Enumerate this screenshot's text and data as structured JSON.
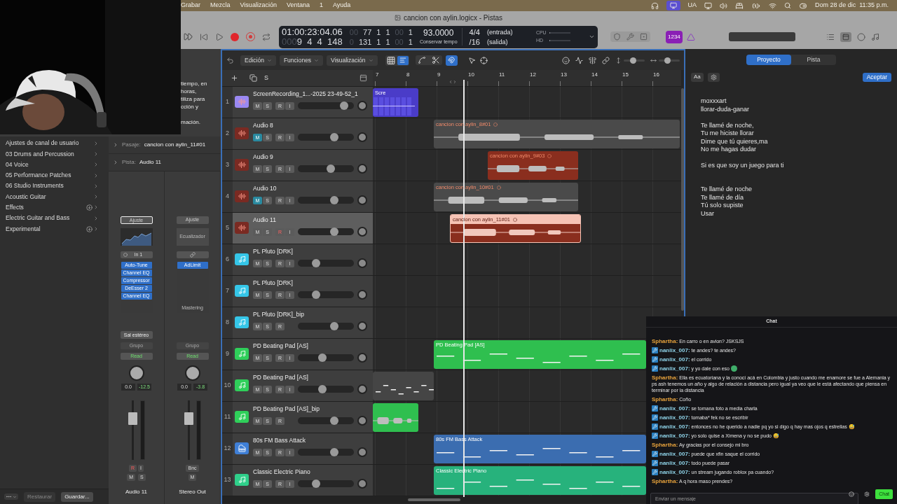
{
  "menubar": {
    "menus": [
      "Grabar",
      "Mezcla",
      "Visualización",
      "Ventana",
      "1",
      "Ayuda"
    ],
    "keyboard_layout": "UA",
    "clock": "Dom 28 de dic  11:35 p.m."
  },
  "window": {
    "title": "cancion con aylin.logicx - Pistas"
  },
  "lcd": {
    "smpte": "01:00:23:04.06",
    "bars": [
      {
        "text": "000",
        "dim": true
      },
      {
        "text": "9  4  4  148",
        "dim": false
      }
    ],
    "locator_in": [
      {
        "text": "00",
        "dim": true
      },
      {
        "text": "77",
        "dim": false
      },
      {
        "text": "1",
        "dim": false
      },
      {
        "text": "1",
        "dim": false
      },
      {
        "text": "00",
        "dim": true
      },
      {
        "text": "1",
        "dim": false
      }
    ],
    "locator_out": [
      {
        "text": "0",
        "dim": true
      },
      {
        "text": "131",
        "dim": false
      },
      {
        "text": "1",
        "dim": false
      },
      {
        "text": "1",
        "dim": false
      },
      {
        "text": "00",
        "dim": true
      },
      {
        "text": "1",
        "dim": false
      }
    ],
    "tempo": "93.0000",
    "tempo_mode": "Conservar tempo",
    "signature": "4/4",
    "division": "/16",
    "input_label": "(entrada)",
    "output_label": "(salida)",
    "meters": [
      {
        "label": "CPU",
        "level": 0.05
      },
      {
        "label": "HD",
        "level": 0.05
      }
    ]
  },
  "count_in": "1234",
  "help_text": [
    [
      "tiempo, en",
      "horas,",
      "tiliza para",
      "cción y"
    ],
    [
      "mación."
    ]
  ],
  "library": {
    "items": [
      {
        "label": "Ajustes de canal de usuario",
        "download": false
      },
      {
        "label": "03 Drums and Percussion",
        "download": false
      },
      {
        "label": "04 Voice",
        "download": false
      },
      {
        "label": "05 Performance Patches",
        "download": false
      },
      {
        "label": "06 Studio Instruments",
        "download": false
      },
      {
        "label": "Acoustic Guitar",
        "download": false
      },
      {
        "label": "Effects",
        "download": true
      },
      {
        "label": "Electric Guitar and Bass",
        "download": false
      },
      {
        "label": "Experimental",
        "download": true
      }
    ],
    "restore": "Restaurar",
    "save": "Guardar..."
  },
  "inspector": {
    "region_row": {
      "label": "Pasaje:",
      "value": "cancion con aylin_11#01"
    },
    "track_row": {
      "label": "Pista:",
      "value": "Audio 11"
    },
    "strips": [
      {
        "setting": "Ajuste",
        "setting_selected": true,
        "input": "In 1",
        "plugins": [
          "Auto-Tune",
          "Channel EQ",
          "Compressor",
          "DeEsser 2",
          "Channel EQ"
        ],
        "output": "Sal estéreo",
        "group": "Grupo",
        "automation": "Read",
        "volume": "0.0",
        "peak": "-12.5",
        "level": 0.75,
        "buttons": [
          {
            "kind": "record",
            "label": "R",
            "on": true
          },
          {
            "kind": "input",
            "label": "I",
            "on": false
          },
          {
            "kind": "mute",
            "label": "M",
            "on": false
          },
          {
            "kind": "solo",
            "label": "S",
            "on": false
          }
        ],
        "name": "Audio 11"
      },
      {
        "setting": "Ajuste",
        "setting_selected": false,
        "eq_label": "Ecualizador",
        "plugins": [
          "AdLimit"
        ],
        "slot_label": "Mastering",
        "group": "Grupo",
        "automation": "Read",
        "volume": "0.0",
        "peak": "-3.8",
        "level": 0.75,
        "buttons": [
          {
            "kind": "bounce",
            "label": "Bnc",
            "on": false
          },
          {
            "kind": "mute",
            "label": "M",
            "on": false
          }
        ],
        "name": "Stereo Out"
      }
    ]
  },
  "tracks_toolbar": {
    "menus": [
      "Edición",
      "Funciones",
      "Visualización"
    ],
    "zoom_sliders": [
      {
        "level": 0.45
      },
      {
        "level": 0.4
      }
    ]
  },
  "track_list_header": {
    "solo_label": "S"
  },
  "ruler": [
    "7",
    "8",
    "9",
    "10",
    "11",
    "12",
    "13",
    "14",
    "15",
    "16"
  ],
  "tracks": [
    {
      "number": "1",
      "name": "ScreenRecording_1...-2025 23-49-52_1",
      "kind": "audio",
      "color": "#9a88f2",
      "selected": false,
      "level": 0.88,
      "buttons": [
        {
          "kind": "mute",
          "label": "M",
          "on": false
        },
        {
          "kind": "solo",
          "label": "S",
          "on": false
        },
        {
          "kind": "record",
          "label": "R",
          "on": false
        },
        {
          "kind": "input",
          "label": "I",
          "on": false
        }
      ],
      "regions": [
        {
          "name": "Scre",
          "kind": "video",
          "color": "#4a3cc8",
          "selected": false,
          "looped": false
        }
      ]
    },
    {
      "number": "2",
      "name": "Audio 8",
      "kind": "audio",
      "color": "#7a2a22",
      "selected": false,
      "level": 0.68,
      "buttons": [
        {
          "kind": "mute",
          "label": "M",
          "on": true
        },
        {
          "kind": "solo",
          "label": "S",
          "on": false
        },
        {
          "kind": "record",
          "label": "R",
          "on": false
        },
        {
          "kind": "input",
          "label": "I",
          "on": false
        }
      ],
      "regions": [
        {
          "name": "cancion con aylin_8#01",
          "kind": "audio",
          "color": "#4a4a4a",
          "selected": false,
          "looped": true
        }
      ]
    },
    {
      "number": "3",
      "name": "Audio 9",
      "kind": "audio",
      "color": "#7a2a22",
      "selected": false,
      "level": 0.6,
      "buttons": [
        {
          "kind": "mute",
          "label": "M",
          "on": false
        },
        {
          "kind": "solo",
          "label": "S",
          "on": false
        },
        {
          "kind": "record",
          "label": "R",
          "on": false
        },
        {
          "kind": "input",
          "label": "I",
          "on": false
        }
      ],
      "regions": [
        {
          "name": "cancion con aylin_9#03",
          "kind": "audio",
          "color": "#8a2e1e",
          "selected": false,
          "looped": true
        }
      ]
    },
    {
      "number": "4",
      "name": "Audio 10",
      "kind": "audio",
      "color": "#7a2a22",
      "selected": false,
      "level": 0.68,
      "buttons": [
        {
          "kind": "mute",
          "label": "M",
          "on": true
        },
        {
          "kind": "solo",
          "label": "S",
          "on": false
        },
        {
          "kind": "record",
          "label": "R",
          "on": false
        },
        {
          "kind": "input",
          "label": "I",
          "on": false
        }
      ],
      "regions": [
        {
          "name": "cancion con aylin_10#01",
          "kind": "audio",
          "color": "#4a4a4a",
          "selected": false,
          "looped": true
        }
      ]
    },
    {
      "number": "5",
      "name": "Audio 11",
      "kind": "audio",
      "color": "#7a2a22",
      "selected": true,
      "level": 0.68,
      "buttons": [
        {
          "kind": "mute",
          "label": "M",
          "on": false
        },
        {
          "kind": "solo",
          "label": "S",
          "on": false
        },
        {
          "kind": "record",
          "label": "R",
          "on": true
        },
        {
          "kind": "input",
          "label": "I",
          "on": false
        }
      ],
      "regions": [
        {
          "name": "cancion con aylin_11#01",
          "kind": "audio",
          "color": "#8a2e1e",
          "selected": true,
          "looped": true
        }
      ]
    },
    {
      "number": "6",
      "name": "PL Pluto [DRK]",
      "kind": "instrument",
      "color": "#35c6e8",
      "selected": false,
      "level": 0.3,
      "buttons": [
        {
          "kind": "mute",
          "label": "M",
          "on": false
        },
        {
          "kind": "solo",
          "label": "S",
          "on": false
        },
        {
          "kind": "record",
          "label": "R",
          "on": false
        },
        {
          "kind": "input",
          "label": "I",
          "on": false
        }
      ]
    },
    {
      "number": "7",
      "name": "PL Pluto [DRK]",
      "kind": "instrument",
      "color": "#35c6e8",
      "selected": false,
      "level": 0.3,
      "buttons": [
        {
          "kind": "mute",
          "label": "M",
          "on": false
        },
        {
          "kind": "solo",
          "label": "S",
          "on": false
        },
        {
          "kind": "record",
          "label": "R",
          "on": false
        },
        {
          "kind": "input",
          "label": "I",
          "on": false
        }
      ]
    },
    {
      "number": "8",
      "name": "PL Pluto [DRK]_bip",
      "kind": "instrument",
      "color": "#35c6e8",
      "selected": false,
      "level": 0.68,
      "buttons": [
        {
          "kind": "mute",
          "label": "M",
          "on": false
        },
        {
          "kind": "solo",
          "label": "S",
          "on": false
        },
        {
          "kind": "record",
          "label": "R",
          "on": false
        }
      ]
    },
    {
      "number": "9",
      "name": "PD Beating Pad [AS]",
      "kind": "instrument",
      "color": "#2fcf5a",
      "selected": false,
      "level": 0.42,
      "buttons": [
        {
          "kind": "mute",
          "label": "M",
          "on": false
        },
        {
          "kind": "solo",
          "label": "S",
          "on": false
        },
        {
          "kind": "record",
          "label": "R",
          "on": false
        },
        {
          "kind": "input",
          "label": "I",
          "on": false
        }
      ],
      "regions": [
        {
          "name": "PD Beating Pad [AS]",
          "kind": "midi",
          "color": "#2fbf4f",
          "selected": false,
          "looped": false
        }
      ]
    },
    {
      "number": "10",
      "name": "PD Beating Pad [AS]",
      "kind": "instrument",
      "color": "#2fcf5a",
      "selected": false,
      "level": 0.42,
      "buttons": [
        {
          "kind": "mute",
          "label": "M",
          "on": false
        },
        {
          "kind": "solo",
          "label": "S",
          "on": false
        },
        {
          "kind": "record",
          "label": "R",
          "on": false
        },
        {
          "kind": "input",
          "label": "I",
          "on": false
        }
      ],
      "regions": [
        {
          "kind": "midi",
          "color": "#454545",
          "selected": false,
          "looped": false
        }
      ]
    },
    {
      "number": "11",
      "name": "PD Beating Pad [AS]_bip",
      "kind": "instrument",
      "color": "#2fcf5a",
      "selected": false,
      "level": 0.68,
      "buttons": [
        {
          "kind": "mute",
          "label": "M",
          "on": false
        },
        {
          "kind": "solo",
          "label": "S",
          "on": false
        },
        {
          "kind": "record",
          "label": "R",
          "on": false
        }
      ],
      "regions": [
        {
          "kind": "audio",
          "color": "#2fbf4f",
          "selected": false,
          "looped": false
        }
      ]
    },
    {
      "number": "12",
      "name": "80s FM Bass Attack",
      "kind": "synth",
      "color": "#3f7fd6",
      "selected": false,
      "level": 0.68,
      "buttons": [
        {
          "kind": "mute",
          "label": "M",
          "on": false
        },
        {
          "kind": "solo",
          "label": "S",
          "on": false
        },
        {
          "kind": "record",
          "label": "R",
          "on": false
        },
        {
          "kind": "input",
          "label": "I",
          "on": false
        }
      ],
      "regions": [
        {
          "name": "80s FM Bass Attack",
          "kind": "midi",
          "color": "#3b6db0",
          "selected": false,
          "looped": false
        }
      ]
    },
    {
      "number": "13",
      "name": "Classic Electric Piano",
      "kind": "instrument",
      "color": "#2fcf8a",
      "selected": false,
      "level": 0.3,
      "buttons": [
        {
          "kind": "mute",
          "label": "M",
          "on": false
        },
        {
          "kind": "solo",
          "label": "S",
          "on": false
        },
        {
          "kind": "record",
          "label": "R",
          "on": false
        },
        {
          "kind": "input",
          "label": "I",
          "on": false
        }
      ],
      "regions": [
        {
          "name": "Classic Electric Piano",
          "kind": "midi",
          "color": "#27b27c",
          "selected": false,
          "looped": false
        }
      ]
    }
  ],
  "notes_panel": {
    "tabs": [
      {
        "label": "Proyecto",
        "selected": true
      },
      {
        "label": "Pista",
        "selected": false
      }
    ],
    "font_button": "Aa",
    "accept": "Aceptar",
    "stanzas": [
      [
        "moxxxart",
        "llorar-duda-ganar"
      ],
      [
        "Te llamé de noche,",
        "Tu me hiciste llorar",
        "Dime que tú quieres,ma",
        "No me hagas dudar"
      ],
      [
        "Si es que soy un juego para ti"
      ],
      [
        "Te llamé de noche",
        "Te llamé de día",
        "Tú solo supiste",
        "Usar"
      ]
    ]
  },
  "chat": {
    "title": "Chat",
    "placeholder": "Enviar un mensaje",
    "send": "Chat",
    "messages": [
      {
        "kind": "text",
        "user": "Sphartha:",
        "color": "#e8a33c",
        "badge": false,
        "text": "En carro o en avion? JSKSJS"
      },
      {
        "kind": "text",
        "user": "nanlix_007:",
        "color": "#8fd3e8",
        "badge": true,
        "text": "te andes? te andes?"
      },
      {
        "kind": "text",
        "user": "nanlix_007:",
        "color": "#8fd3e8",
        "badge": true,
        "text": "el corrido"
      },
      {
        "kind": "emote",
        "user": "nanlix_007:",
        "color": "#8fd3e8",
        "badge": true,
        "text": "y yo dale con eso"
      },
      {
        "kind": "text",
        "user": "Sphartha:",
        "color": "#e8a33c",
        "badge": false,
        "text": "Ella es ecuatoriana y la conocí acá en Colombia y justo cuando me enamore se fue a Alemania y ps ash tenemos un año y algo de relación a distancia pero igual ya veo que le está afectando que piensa en terminar por la distancia"
      },
      {
        "kind": "text",
        "user": "Sphartha:",
        "color": "#e8a33c",
        "badge": false,
        "text": "Coño"
      },
      {
        "kind": "text",
        "user": "nanlix_007:",
        "color": "#8fd3e8",
        "badge": true,
        "text": "se tomana foto a media charla"
      },
      {
        "kind": "text",
        "user": "nanlix_007:",
        "color": "#8fd3e8",
        "badge": true,
        "text": "tomaba* fek no se escribir"
      },
      {
        "kind": "text",
        "user": "nanlix_007:",
        "color": "#8fd3e8",
        "badge": true,
        "text": "entonces no he querido a nadie pq yo si digo q hay mas ojos q estrellas 😅"
      },
      {
        "kind": "text",
        "user": "nanlix_007:",
        "color": "#8fd3e8",
        "badge": true,
        "text": "yo solo quise a Ximena y no se pudo 😅"
      },
      {
        "kind": "text",
        "user": "Sphartha:",
        "color": "#e8a33c",
        "badge": false,
        "text": "Ay gracias por el consejo mi bro"
      },
      {
        "kind": "text",
        "user": "nanlix_007:",
        "color": "#8fd3e8",
        "badge": true,
        "text": "puede que xfin saque el corrido"
      },
      {
        "kind": "text",
        "user": "nanlix_007:",
        "color": "#8fd3e8",
        "badge": true,
        "text": "todo puede pasar"
      },
      {
        "kind": "text",
        "user": "nanlix_007:",
        "color": "#8fd3e8",
        "badge": true,
        "text": "un stream jugando roblox pa cuando?"
      },
      {
        "kind": "text",
        "user": "Sphartha:",
        "color": "#e8a33c",
        "badge": false,
        "text": "A q hora maso prendes?"
      }
    ]
  }
}
